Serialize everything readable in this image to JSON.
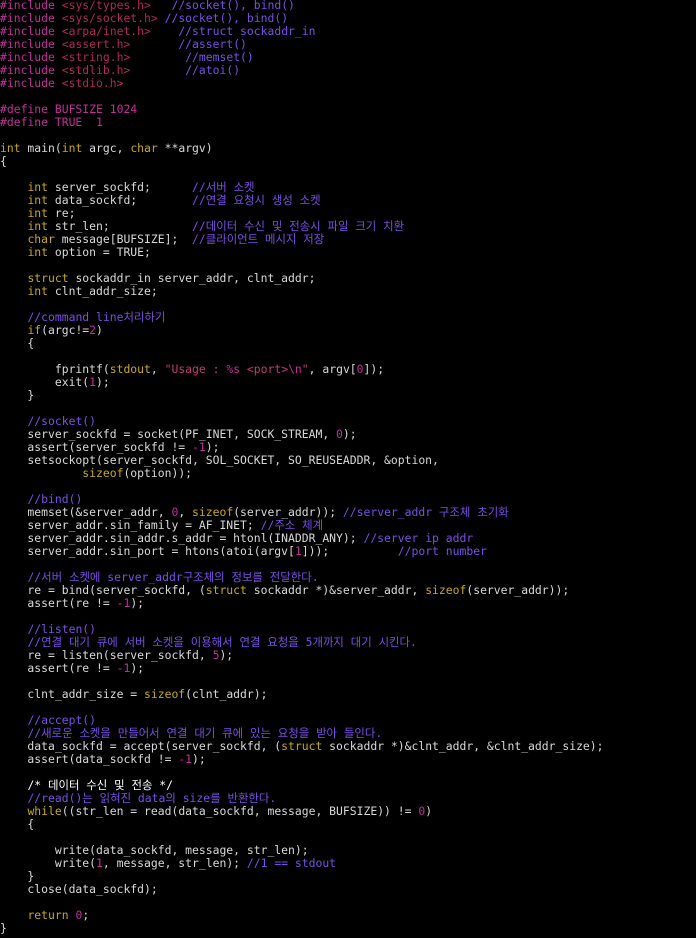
{
  "editor": {
    "background": "#000000",
    "colors": {
      "default": "#d8d8d8",
      "preprocessor": "#c0309a",
      "header": "#b0285a",
      "comment": "#7a4ee6",
      "keyword": "#c8a81a",
      "string": "#c03c74",
      "number": "#c0309a"
    },
    "lines": [
      [
        [
          "pp",
          "#include "
        ],
        [
          "hdr",
          "<sys/types.h>"
        ],
        [
          "d",
          "   "
        ],
        [
          "cm",
          "//socket(), bind()"
        ]
      ],
      [
        [
          "pp",
          "#include "
        ],
        [
          "hdr",
          "<sys/socket.h>"
        ],
        [
          "d",
          " "
        ],
        [
          "cm",
          "//socket(), bind()"
        ]
      ],
      [
        [
          "pp",
          "#include "
        ],
        [
          "hdr",
          "<arpa/inet.h>"
        ],
        [
          "d",
          "    "
        ],
        [
          "cm",
          "//struct sockaddr_in"
        ]
      ],
      [
        [
          "pp",
          "#include "
        ],
        [
          "hdr",
          "<assert.h>"
        ],
        [
          "d",
          "       "
        ],
        [
          "cm",
          "//assert()"
        ]
      ],
      [
        [
          "pp",
          "#include "
        ],
        [
          "hdr",
          "<string.h>"
        ],
        [
          "d",
          "        "
        ],
        [
          "cm",
          "//memset()"
        ]
      ],
      [
        [
          "pp",
          "#include "
        ],
        [
          "hdr",
          "<stdlib.h>"
        ],
        [
          "d",
          "        "
        ],
        [
          "cm",
          "//atoi()"
        ]
      ],
      [
        [
          "pp",
          "#include "
        ],
        [
          "hdr",
          "<stdio.h>"
        ]
      ],
      [],
      [
        [
          "pp",
          "#define BUFSIZE "
        ],
        [
          "num",
          "1024"
        ]
      ],
      [
        [
          "pp",
          "#define TRUE  "
        ],
        [
          "num",
          "1"
        ]
      ],
      [],
      [
        [
          "kw",
          "int"
        ],
        [
          "d",
          " main("
        ],
        [
          "kw",
          "int"
        ],
        [
          "d",
          " argc, "
        ],
        [
          "kw",
          "char"
        ],
        [
          "d",
          " **argv)"
        ]
      ],
      [
        [
          "d",
          "{"
        ]
      ],
      [],
      [
        [
          "d",
          "    "
        ],
        [
          "kw",
          "int"
        ],
        [
          "d",
          " server_sockfd;      "
        ],
        [
          "cm",
          "//서버 소켓"
        ]
      ],
      [
        [
          "d",
          "    "
        ],
        [
          "kw",
          "int"
        ],
        [
          "d",
          " data_sockfd;        "
        ],
        [
          "cm",
          "//연결 요청시 생성 소켓"
        ]
      ],
      [
        [
          "d",
          "    "
        ],
        [
          "kw",
          "int"
        ],
        [
          "d",
          " re;"
        ]
      ],
      [
        [
          "d",
          "    "
        ],
        [
          "kw",
          "int"
        ],
        [
          "d",
          " str_len;            "
        ],
        [
          "cm",
          "//데이터 수신 및 전송시 파일 크기 치환"
        ]
      ],
      [
        [
          "d",
          "    "
        ],
        [
          "kw",
          "char"
        ],
        [
          "d",
          " message[BUFSIZE];  "
        ],
        [
          "cm",
          "//클라이언트 메시지 저장"
        ]
      ],
      [
        [
          "d",
          "    "
        ],
        [
          "kw",
          "int"
        ],
        [
          "d",
          " option = TRUE;"
        ]
      ],
      [],
      [
        [
          "d",
          "    "
        ],
        [
          "kw",
          "struct"
        ],
        [
          "d",
          " sockaddr_in server_addr, clnt_addr;"
        ]
      ],
      [
        [
          "d",
          "    "
        ],
        [
          "kw",
          "int"
        ],
        [
          "d",
          " clnt_addr_size;"
        ]
      ],
      [],
      [
        [
          "d",
          "    "
        ],
        [
          "cm",
          "//command line처리하기"
        ]
      ],
      [
        [
          "d",
          "    "
        ],
        [
          "kw",
          "if"
        ],
        [
          "d",
          "(argc!="
        ],
        [
          "num",
          "2"
        ],
        [
          "d",
          ")"
        ]
      ],
      [
        [
          "d",
          "    {"
        ]
      ],
      [],
      [
        [
          "d",
          "        fprintf("
        ],
        [
          "kw",
          "stdout"
        ],
        [
          "d",
          ", "
        ],
        [
          "str",
          "\"Usage : "
        ],
        [
          "esc",
          "%s"
        ],
        [
          "str",
          " <port>"
        ],
        [
          "esc",
          "\\n"
        ],
        [
          "str",
          "\""
        ],
        [
          "d",
          ", argv["
        ],
        [
          "num",
          "0"
        ],
        [
          "d",
          "]);"
        ]
      ],
      [
        [
          "d",
          "        exit("
        ],
        [
          "num",
          "1"
        ],
        [
          "d",
          ");"
        ]
      ],
      [
        [
          "d",
          "    }"
        ]
      ],
      [],
      [
        [
          "d",
          "    "
        ],
        [
          "cm",
          "//socket()"
        ]
      ],
      [
        [
          "d",
          "    server_sockfd = socket(PF_INET, SOCK_STREAM, "
        ],
        [
          "num",
          "0"
        ],
        [
          "d",
          ");"
        ]
      ],
      [
        [
          "d",
          "    assert(server_sockfd != "
        ],
        [
          "num",
          "-1"
        ],
        [
          "d",
          ");"
        ]
      ],
      [
        [
          "d",
          "    setsockopt(server_sockfd, SOL_SOCKET, SO_REUSEADDR, &option,"
        ]
      ],
      [
        [
          "d",
          "            "
        ],
        [
          "kw",
          "sizeof"
        ],
        [
          "d",
          "(option));"
        ]
      ],
      [],
      [
        [
          "d",
          "    "
        ],
        [
          "cm",
          "//bind()"
        ]
      ],
      [
        [
          "d",
          "    memset(&server_addr, "
        ],
        [
          "num",
          "0"
        ],
        [
          "d",
          ", "
        ],
        [
          "kw",
          "sizeof"
        ],
        [
          "d",
          "(server_addr)); "
        ],
        [
          "cm",
          "//server_addr 구조체 초기화"
        ]
      ],
      [
        [
          "d",
          "    server_addr.sin_family = AF_INET; "
        ],
        [
          "cm",
          "//주소 체계"
        ]
      ],
      [
        [
          "d",
          "    server_addr.sin_addr.s_addr = htonl(INADDR_ANY); "
        ],
        [
          "cm",
          "//server ip addr"
        ]
      ],
      [
        [
          "d",
          "    server_addr.sin_port = htons(atoi(argv["
        ],
        [
          "num",
          "1"
        ],
        [
          "d",
          "]));          "
        ],
        [
          "cm",
          "//port number"
        ]
      ],
      [],
      [
        [
          "d",
          "    "
        ],
        [
          "cm",
          "//서버 소켓에 server_addr구조체의 정보를 전달한다."
        ]
      ],
      [
        [
          "d",
          "    re = bind(server_sockfd, ("
        ],
        [
          "kw",
          "struct"
        ],
        [
          "d",
          " sockaddr *)&server_addr, "
        ],
        [
          "kw",
          "sizeof"
        ],
        [
          "d",
          "(server_addr));"
        ]
      ],
      [
        [
          "d",
          "    assert(re != "
        ],
        [
          "num",
          "-1"
        ],
        [
          "d",
          ");"
        ]
      ],
      [],
      [
        [
          "d",
          "    "
        ],
        [
          "cm",
          "//listen()"
        ]
      ],
      [
        [
          "d",
          "    "
        ],
        [
          "cm",
          "//연결 대기 큐에 서버 소켓을 이용해서 연결 요청을 5개까지 대기 시킨다."
        ]
      ],
      [
        [
          "d",
          "    re = listen(server_sockfd, "
        ],
        [
          "num",
          "5"
        ],
        [
          "d",
          ");"
        ]
      ],
      [
        [
          "d",
          "    assert(re != "
        ],
        [
          "num",
          "-1"
        ],
        [
          "d",
          ");"
        ]
      ],
      [],
      [
        [
          "d",
          "    clnt_addr_size = "
        ],
        [
          "kw",
          "sizeof"
        ],
        [
          "d",
          "(clnt_addr);"
        ]
      ],
      [],
      [
        [
          "d",
          "    "
        ],
        [
          "cm",
          "//accept()"
        ]
      ],
      [
        [
          "d",
          "    "
        ],
        [
          "cm",
          "//새로운 소켓을 만들어서 연결 대기 큐에 있는 요청을 받아 들인다."
        ]
      ],
      [
        [
          "d",
          "    data_sockfd = accept(server_sockfd, ("
        ],
        [
          "kw",
          "struct"
        ],
        [
          "d",
          " sockaddr *)&clnt_addr, &clnt_addr_size);"
        ]
      ],
      [
        [
          "d",
          "    assert(data_sockfd != "
        ],
        [
          "num",
          "-1"
        ],
        [
          "d",
          ");"
        ]
      ],
      [],
      [
        [
          "d",
          "    "
        ],
        [
          "cur",
          "/* 데이터 수신 및 전송 */"
        ]
      ],
      [
        [
          "d",
          "    "
        ],
        [
          "cm",
          "//read()는 읽혀진 data의 size를 반환한다."
        ]
      ],
      [
        [
          "d",
          "    "
        ],
        [
          "kw",
          "while"
        ],
        [
          "d",
          "((str_len = read(data_sockfd, message, BUFSIZE)) != "
        ],
        [
          "num",
          "0"
        ],
        [
          "d",
          ")"
        ]
      ],
      [
        [
          "d",
          "    {"
        ]
      ],
      [],
      [
        [
          "d",
          "        write(data_sockfd, message, str_len);"
        ]
      ],
      [
        [
          "d",
          "        write("
        ],
        [
          "num",
          "1"
        ],
        [
          "d",
          ", message, str_len); "
        ],
        [
          "cm",
          "//1 == stdout"
        ]
      ],
      [
        [
          "d",
          "    }"
        ]
      ],
      [
        [
          "d",
          "    close(data_sockfd);"
        ]
      ],
      [],
      [
        [
          "d",
          "    "
        ],
        [
          "kw",
          "return"
        ],
        [
          "d",
          " "
        ],
        [
          "num",
          "0"
        ],
        [
          "d",
          ";"
        ]
      ],
      [
        [
          "d",
          "}"
        ]
      ]
    ]
  }
}
